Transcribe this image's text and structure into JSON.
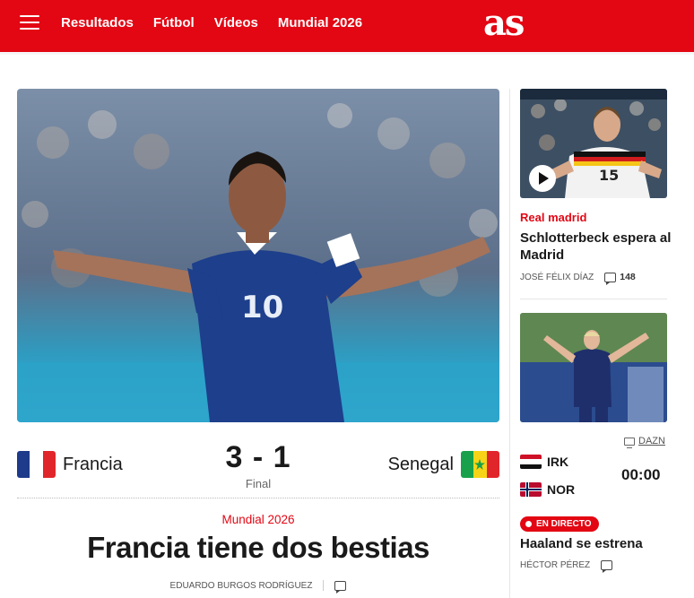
{
  "header": {
    "logo": "as",
    "nav": [
      "Resultados",
      "Fútbol",
      "Vídeos",
      "Mundial 2026"
    ]
  },
  "main": {
    "match": {
      "home": "Francia",
      "away": "Senegal",
      "score": "3 - 1",
      "status": "Final"
    },
    "kicker": "Mundial 2026",
    "headline": "Francia tiene dos bestias",
    "author": "EDUARDO BURGOS RODRÍGUEZ"
  },
  "side": {
    "card1": {
      "kicker": "Real madrid",
      "title": "Schlotterbeck espera al Madrid",
      "author": "JOSÉ FÉLIX DÍAZ",
      "comments": "148"
    },
    "card2": {
      "tv": "DAZN",
      "team1": "IRK",
      "team2": "NOR",
      "time": "00:00",
      "live": "EN DIRECTO",
      "title": "Haaland se estrena",
      "author": "HÉCTOR PÉREZ"
    }
  },
  "colors": {
    "brand": "#e30613",
    "france_blue": "#1d3f8c"
  }
}
